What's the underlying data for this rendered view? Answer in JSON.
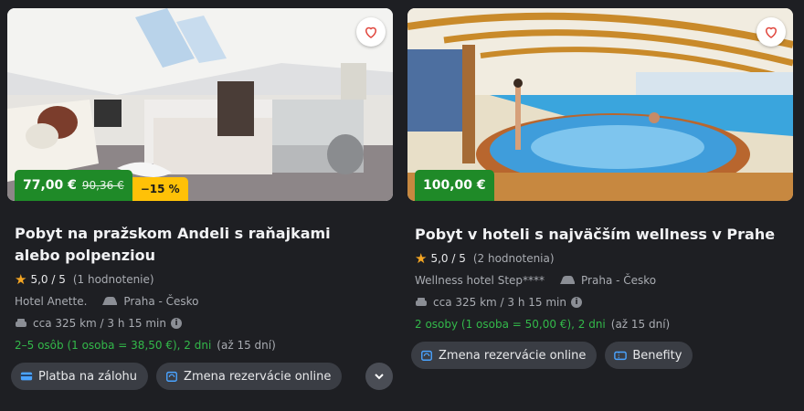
{
  "cards": [
    {
      "price": "77,00 €",
      "old_price": "90,36 €",
      "discount": "−15 %",
      "title_line1": "Pobyt na pražskom Andeli s raňajkami",
      "title_line2": "alebo polpenziou",
      "rating": "5,0 / 5",
      "reviews": "(1 hodnotenie)",
      "hotel": "Hotel Anette.",
      "location": "Praha - Česko",
      "distance": "cca 325 km / 3 h 15 min",
      "persons": "2–5 osôb (1 osoba = 38,50 €), 2 dni",
      "duration": "(až 15 dní)",
      "chip1": "Platba na zálohu",
      "chip2": "Zmena rezervácie online"
    },
    {
      "price": "100,00 €",
      "title_line1": "Pobyt v hoteli s najväčším wellness v Prahe",
      "rating": "5,0 / 5",
      "reviews": "(2 hodnotenia)",
      "hotel": "Wellness hotel Step****",
      "location": "Praha - Česko",
      "distance": "cca 325 km / 3 h 15 min",
      "persons": "2 osoby (1 osoba = 50,00 €), 2 dni",
      "duration": "(až 15 dní)",
      "chip1": "Zmena rezervácie online",
      "chip2": "Benefity"
    }
  ],
  "colors": {
    "price_green": "#1f8a28",
    "discount_yellow": "#ffc107",
    "star": "#f5a623",
    "text_green": "#33b94a"
  },
  "icons": [
    "heart-icon",
    "star-icon",
    "car-icon",
    "road-icon",
    "info-icon",
    "card-icon",
    "calendar-sync-icon",
    "ticket-icon",
    "chevron-down-icon"
  ]
}
